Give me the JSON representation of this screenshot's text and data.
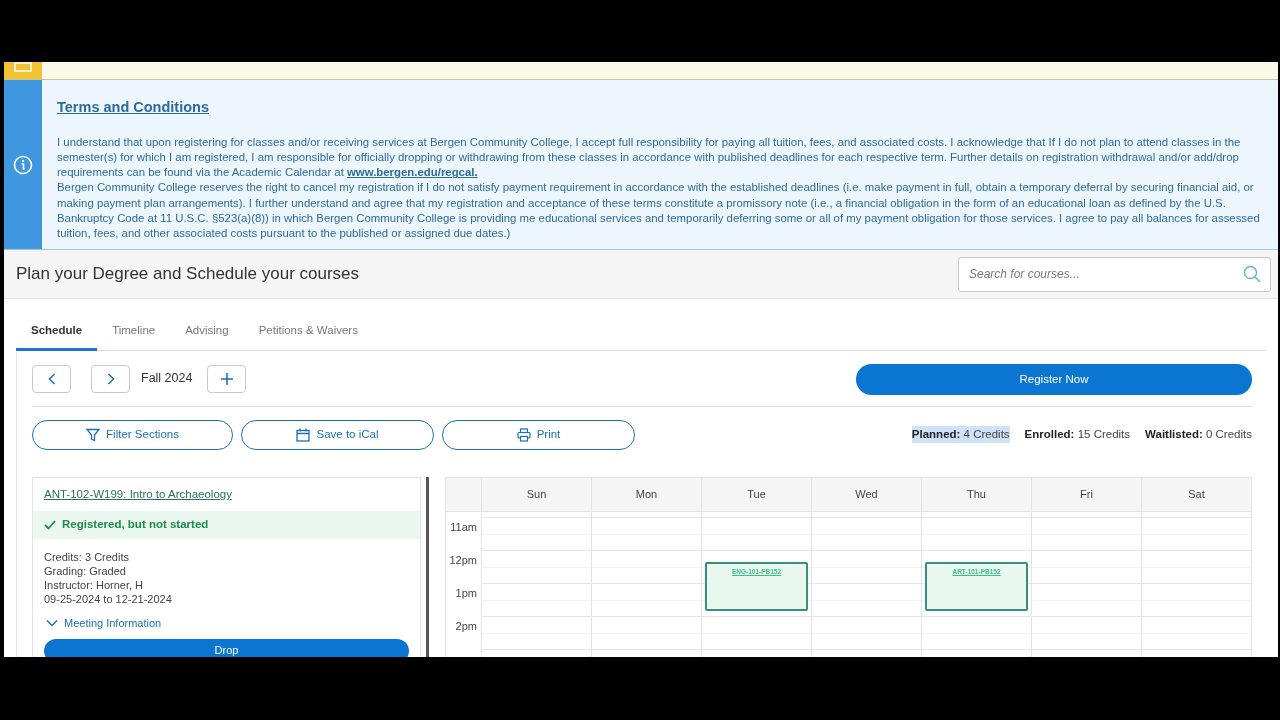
{
  "terms": {
    "title": "Terms and Conditions",
    "paragraph_1": "I understand that upon registering for classes and/or receiving services at Bergen Community College, I accept full responsibility for paying all tuition, fees, and associated costs. I acknowledge that If I do not plan to attend classes in the semester(s) for which I am registered, I am responsible for officially dropping or withdrawing from these classes in accordance with published deadlines for each respective term. Further details on registration withdrawal and/or add/drop requirements can be found via the Academic Calendar at",
    "link": "www.bergen.edu/regcal.",
    "paragraph_2": "Bergen Community College reserves the right to cancel my registration if I do not satisfy payment requirement in accordance with the established deadlines (i.e. make payment in full, obtain a temporary deferral by securing financial aid, or making payment plan arrangements). I further understand and agree that my registration and acceptance of these terms constitute a promissory note (i.e., a financial obligation in the form of an educational loan as defined by the U.S. Bankruptcy Code at 11 U.S.C. §523(a)(8)) in which Bergen Community College is providing me educational services and temporarily deferring some or all of my payment obligation for those services. I agree to pay all balances for assessed tuition, fees, and other associated costs pursuant to the published or assigned due dates.)"
  },
  "header": {
    "title": "Plan your Degree and Schedule your courses",
    "search": {
      "placeholder": "Search for courses..."
    }
  },
  "tabs": [
    {
      "label": "Schedule",
      "selected": true
    },
    {
      "label": "Timeline",
      "selected": false
    },
    {
      "label": "Advising",
      "selected": false
    },
    {
      "label": "Petitions & Waivers",
      "selected": false
    }
  ],
  "term_nav": {
    "term": "Fall 2024"
  },
  "register_button": "Register Now",
  "actions": [
    {
      "label": "Filter Sections",
      "kind": "filter"
    },
    {
      "label": "Save to iCal",
      "kind": "calendar"
    },
    {
      "label": "Print",
      "kind": "print"
    }
  ],
  "credits": [
    {
      "label": "Planned:",
      "value": "4 Credits",
      "highlighted": true
    },
    {
      "label": "Enrolled:",
      "value": "15 Credits",
      "highlighted": false
    },
    {
      "label": "Waitlisted:",
      "value": "0 Credits",
      "highlighted": false
    }
  ],
  "course_card": {
    "title": "ANT-102-W199: Intro to Archaeology",
    "status": "Registered, but not started",
    "details": [
      "Credits: 3 Credits",
      "Grading: Graded",
      "Instructor: Horner, H",
      "09-25-2024 to 12-21-2024"
    ],
    "meeting_toggle": "Meeting Information",
    "expanded": false,
    "drop_button": "Drop"
  },
  "calendar": {
    "hours": [
      "11am",
      "12pm",
      "1pm",
      "2pm"
    ],
    "days": [
      {
        "label": "Sun"
      },
      {
        "label": "Mon"
      },
      {
        "label": "Tue",
        "events": [
          {
            "label": "ENG-101-PB152"
          }
        ]
      },
      {
        "label": "Wed"
      },
      {
        "label": "Thu",
        "events": [
          {
            "label": "ART-101-PB152"
          }
        ]
      },
      {
        "label": "Fri"
      },
      {
        "label": "Sat"
      }
    ]
  }
}
